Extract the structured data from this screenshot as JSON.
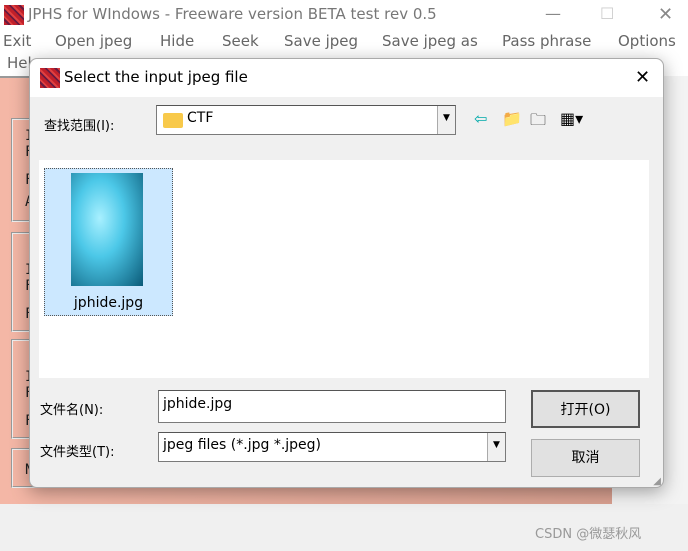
{
  "app": {
    "title": "JPHS for WIndows - Freeware version BETA test rev 0.5",
    "menu": [
      "Exit",
      "Open jpeg",
      "Hide",
      "Seek",
      "Save jpeg",
      "Save jpeg as",
      "Pass phrase",
      "Options",
      "Help"
    ],
    "bg_group_letters": [
      [
        "I",
        "F",
        "F",
        "A"
      ],
      [
        "I",
        "F",
        "F"
      ],
      [
        "I",
        "F",
        "F"
      ],
      [
        "N"
      ]
    ]
  },
  "dialog": {
    "title": "Select the input jpeg file",
    "look_in_label": "查找范围(I):",
    "look_in_value": "CTF",
    "files": [
      {
        "name": "jphide.jpg",
        "selected": true
      }
    ],
    "filename_label": "文件名(N):",
    "filename_value": "jphide.jpg",
    "filetype_label": "文件类型(T):",
    "filetype_value": "jpeg files (*.jpg *.jpeg)",
    "open_button": "打开(O)",
    "cancel_button": "取消",
    "toolbar_icons": [
      "back-arrow-icon",
      "up-folder-icon",
      "new-folder-icon",
      "view-menu-icon"
    ]
  },
  "watermark": "CSDN @微瑟秋风",
  "colors": {
    "salmon": "#f4b7a6",
    "selection": "#cce8ff"
  }
}
